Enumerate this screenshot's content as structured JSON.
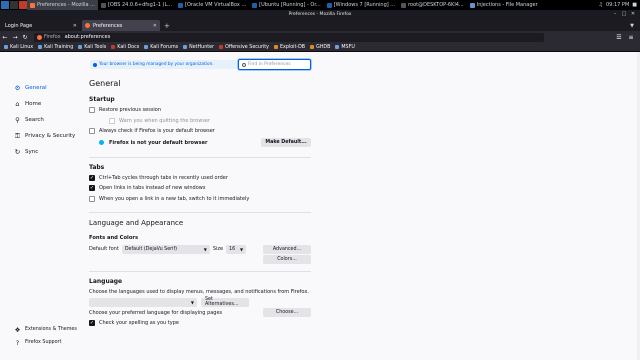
{
  "taskbar": {
    "apps": [
      {
        "label": "",
        "color": "#2a6db5"
      },
      {
        "label": "",
        "color": "#444"
      },
      {
        "label": "",
        "color": "#c23a2b"
      },
      {
        "label": "Preferences - Mozilla ...",
        "color": "#ff7139",
        "active": true
      },
      {
        "label": "[OBS 24.0.6+dfsg1-1 (L...",
        "color": "#333"
      },
      {
        "label": "[Oracle VM VirtualBox ...",
        "color": "#1f60a8"
      },
      {
        "label": "[Ubuntu [Running] - Or...",
        "color": "#1f60a8"
      },
      {
        "label": "[Windows 7 [Running] ...",
        "color": "#1f60a8"
      },
      {
        "label": "root@DESKTOP-6KI4...",
        "color": "#333"
      },
      {
        "label": "Injections - File Manager",
        "color": "#6a8fd1"
      }
    ],
    "time": "09:17 PM"
  },
  "window": {
    "title": "Preferences - Mozilla Firefox"
  },
  "tabs": [
    {
      "label": "Login Page",
      "selected": false
    },
    {
      "label": "Preferences",
      "selected": true
    }
  ],
  "url": {
    "brand": "Firefox",
    "value": "about:preferences"
  },
  "bookmarks": [
    "Kali Linux",
    "Kali Training",
    "Kali Tools",
    "Kali Docs",
    "Kali Forums",
    "NetHunter",
    "Offensive Security",
    "Exploit-DB",
    "GHDB",
    "MSFU"
  ],
  "policy_notice": "Your browser is being managed by your organization.",
  "find": {
    "placeholder": "Find in Preferences"
  },
  "sidebar": {
    "items": [
      {
        "label": "General",
        "icon": "gear-icon",
        "selected": true
      },
      {
        "label": "Home",
        "icon": "home-icon"
      },
      {
        "label": "Search",
        "icon": "search-icon"
      },
      {
        "label": "Privacy & Security",
        "icon": "lock-icon"
      },
      {
        "label": "Sync",
        "icon": "sync-icon"
      }
    ],
    "footer": [
      {
        "label": "Extensions & Themes",
        "icon": "puzzle-icon"
      },
      {
        "label": "Firefox Support",
        "icon": "help-icon"
      }
    ]
  },
  "general": {
    "title": "General",
    "startup": {
      "heading": "Startup",
      "restore": "Restore previous session",
      "warn": "Warn you when quitting the browser",
      "check_default": "Always check if Firefox is your default browser",
      "not_default": "Firefox is not your default browser",
      "make_default": "Make Default..."
    },
    "tabs": {
      "heading": "Tabs",
      "ctrl_tab": "Ctrl+Tab cycles through tabs in recently used order",
      "open_links": "Open links in tabs instead of new windows",
      "switch_new": "When you open a link in a new tab, switch to it immediately"
    },
    "language_appearance": {
      "heading": "Language and Appearance",
      "fonts_heading": "Fonts and Colors",
      "default_font_label": "Default font",
      "default_font_value": "Default (DejaVu Serif)",
      "size_label": "Size",
      "size_value": "16",
      "advanced": "Advanced...",
      "colors": "Colors..."
    },
    "language": {
      "heading": "Language",
      "desc": "Choose the languages used to display menus, messages, and notifications from Firefox.",
      "set_alternatives": "Set Alternatives...",
      "pref_lang": "Choose your preferred language for displaying pages",
      "choose": "Choose...",
      "spelling": "Check your spelling as you type"
    }
  }
}
